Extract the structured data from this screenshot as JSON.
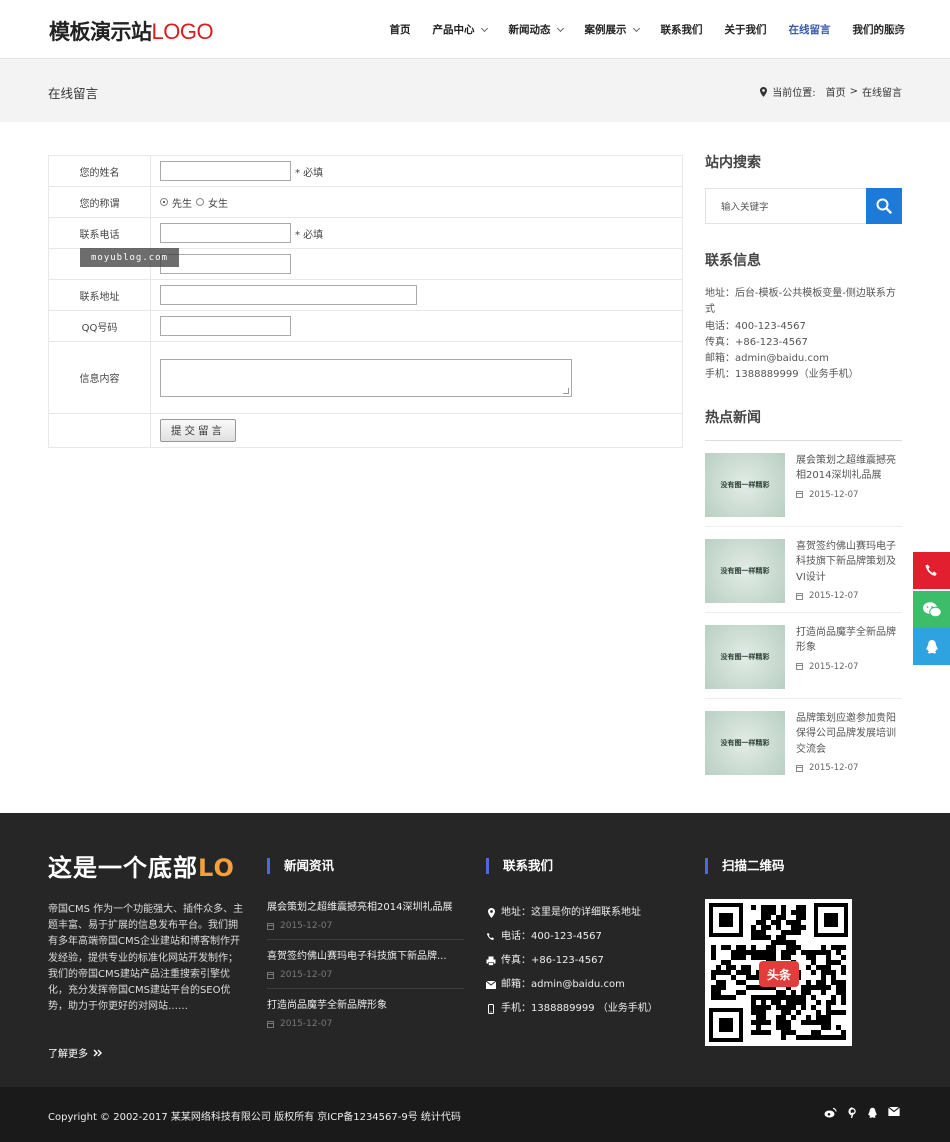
{
  "header": {
    "logo_text": "模板演示站",
    "logo_accent": "LOGO",
    "nav": [
      {
        "label": "首页",
        "has_dropdown": false,
        "active": false
      },
      {
        "label": "产品中心",
        "has_dropdown": true,
        "active": false
      },
      {
        "label": "新闻动态",
        "has_dropdown": true,
        "active": false
      },
      {
        "label": "案例展示",
        "has_dropdown": true,
        "active": false
      },
      {
        "label": "联系我们",
        "has_dropdown": false,
        "active": false
      },
      {
        "label": "关于我们",
        "has_dropdown": false,
        "active": false
      },
      {
        "label": "在线留言",
        "has_dropdown": false,
        "active": true
      },
      {
        "label": "我们的服务",
        "has_dropdown": false,
        "active": false
      }
    ]
  },
  "titlebar": {
    "title": "在线留言",
    "breadcrumb_label": "当前位置:",
    "breadcrumb": [
      "首页",
      "在线留言"
    ],
    "breadcrumb_sep": ">"
  },
  "form": {
    "name_label": "您的姓名",
    "required_text": "* 必填",
    "title_label": "您的称谓",
    "title_options": [
      "先生",
      "女生"
    ],
    "title_selected": "先生",
    "phone_label": "联系电话",
    "address_label": "联系地址",
    "qq_label": "QQ号码",
    "content_label": "信息内容",
    "submit_label": "提交留言"
  },
  "watermark": "moyublog.com",
  "sidebar": {
    "search_title": "站内搜索",
    "search_placeholder": "输入关键字",
    "contact_title": "联系信息",
    "contact_lines": [
      "地址：后台-模板-公共模板变量-侧边联系方式",
      "电话：400-123-4567",
      "传真：+86-123-4567",
      "邮箱：admin@baidu.com",
      "手机：1388889999（业务手机）"
    ],
    "hot_title": "热点新闻",
    "thumb_text": "没有图一样精彩",
    "news": [
      {
        "title": "展会策划之超维震撼亮相2014深圳礼品展",
        "date": "2015-12-07"
      },
      {
        "title": "喜贺签约佛山赛玛电子科技旗下新品牌策划及VI设计",
        "date": "2015-12-07"
      },
      {
        "title": "打造尚品魔芋全新品牌形象",
        "date": "2015-12-07"
      },
      {
        "title": "品牌策划应邀参加贵阳保得公司品牌发展培训交流会",
        "date": "2015-12-07"
      }
    ]
  },
  "footer": {
    "brand": "这是一个底部",
    "brand_accent": "LO",
    "about": "帝国CMS 作为一个功能强大、插件众多、主题丰富、易于扩展的信息发布平台。我们拥有多年高端帝国CMS企业建站和博客制作开发经验，提供专业的标准化网站开发制作；我们的帝国CMS建站产品注重搜索引擎优化，充分发挥帝国CMS建站平台的SEO优势，助力于你更好的对网站……",
    "more_label": "了解更多",
    "news_title": "新闻资讯",
    "news": [
      {
        "title": "展会策划之超维震撼亮相2014深圳礼品展",
        "date": "2015-12-07"
      },
      {
        "title": "喜贺签约佛山赛玛电子科技旗下新品牌...",
        "date": "2015-12-07"
      },
      {
        "title": "打造尚品魔芋全新品牌形象",
        "date": "2015-12-07"
      }
    ],
    "contact_title": "联系我们",
    "contact": {
      "address": "地址：这里是你的详细联系地址",
      "phone": "电话：400-123-4567",
      "fax": "传真：+86-123-4567",
      "email": "邮箱：admin@baidu.com",
      "mobile": "手机：1388889999 （业务手机）"
    },
    "qr_title": "扫描二维码",
    "qr_badge": "头条",
    "copyright": "Copyright © 2002-2017 某某网络科技有限公司 版权所有 京ICP备1234567-9号 统计代码"
  },
  "colors": {
    "accent_blue": "#1e7ad8",
    "logo_red": "#d81e1e",
    "footer_bg": "#262626",
    "float_phone": "#e11f2e",
    "float_wechat": "#3dbd6a",
    "float_qq": "#2fa3e0"
  }
}
